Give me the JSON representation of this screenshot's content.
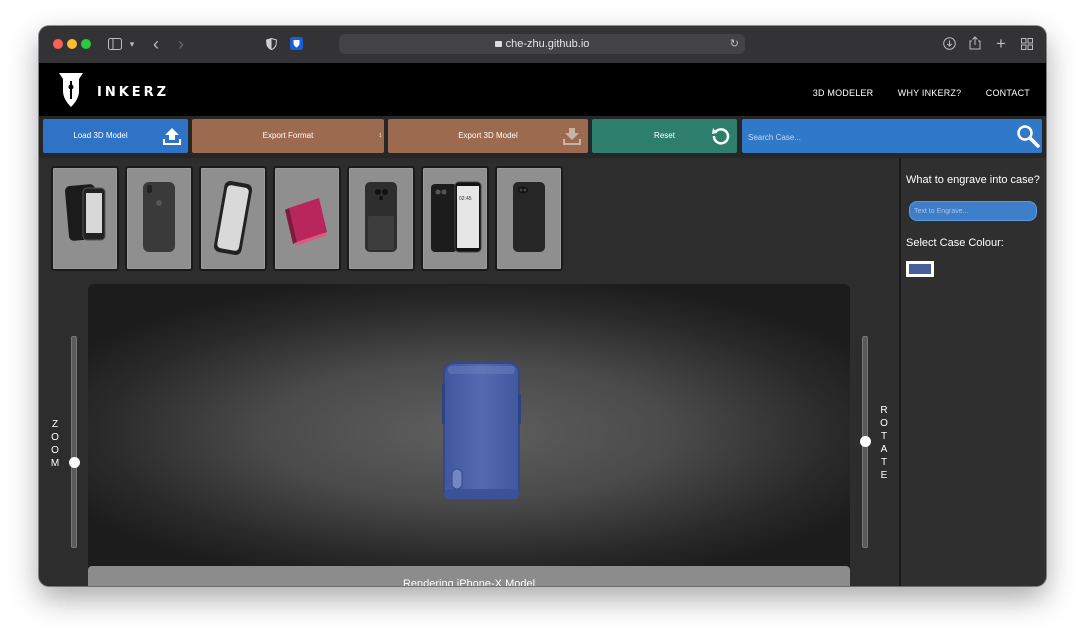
{
  "browser": {
    "url": "che-zhu.github.io"
  },
  "header": {
    "logo_text": "INKERZ",
    "nav": [
      "3D MODELER",
      "WHY INKERZ?",
      "CONTACT"
    ]
  },
  "toolbar": {
    "load_label": "Load 3D Model",
    "export_format_label": "Export Format",
    "export_model_label": "Export 3D Model",
    "reset_label": "Reset",
    "search_placeholder": "Search Case..."
  },
  "cases": [
    {
      "name": "case-thumb-1"
    },
    {
      "name": "case-thumb-2"
    },
    {
      "name": "case-thumb-3"
    },
    {
      "name": "case-thumb-4"
    },
    {
      "name": "case-thumb-5"
    },
    {
      "name": "case-thumb-6",
      "screen_time": "02:45"
    },
    {
      "name": "case-thumb-7"
    }
  ],
  "viewer": {
    "zoom_label": "ZOOM",
    "rotate_label": "ROTATE",
    "zoom_level": 0.4,
    "rotate_level": 0.5,
    "status": "Rendering iPhone-X Model"
  },
  "side_panel": {
    "engrave_question": "What to engrave into case?",
    "engrave_placeholder": "Text to Engrave...",
    "colour_label": "Select Case Colour:",
    "selected_colour": "#4a5f9a"
  },
  "colors": {
    "accent_blue": "#2e73c6",
    "brown": "#9c6a4e",
    "teal": "#2e7e6e",
    "case_blue": "#4a62a8"
  }
}
